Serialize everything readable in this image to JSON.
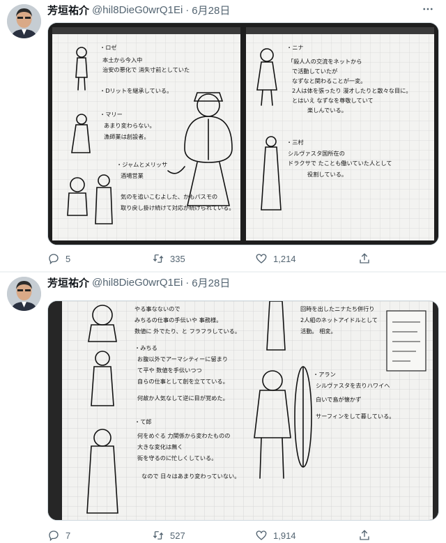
{
  "tweets": [
    {
      "author": {
        "name": "芳垣祐介",
        "handle": "@hil8DieG0wrQ1Ei"
      },
      "date": "6月28日",
      "metrics": {
        "replies": "5",
        "retweets": "335",
        "likes": "1,214"
      },
      "media_text": {
        "left": [
          "・ロゼ",
          "本土から今入中",
          "治安の悪化で 消失寸前としていた",
          "・Dリットを継承している。",
          "・マリー",
          "あまり変わらない。",
          "漁師業は創設者。",
          "・ジャムとメリッサ",
          "酒場営業",
          "気のを追いこむよした、かもパスモの",
          "取り戻し掛け続けて対応が続けられている。"
        ],
        "right": [
          "・ニナ",
          "「殺人人の交流をネットから",
          "で活動していたが",
          "なずなと関わることが一変。",
          "2人は体を張ったり 漫才したりと散々な目に。",
          "とはいえ なずなを尊敬していて",
          "楽しんでいる。",
          "・三村",
          "シルヴァスタ国所在の",
          "ドラクサで たことも働いていた人として",
          "役割している。"
        ]
      }
    },
    {
      "author": {
        "name": "芳垣祐介",
        "handle": "@hil8DieG0wrQ1Ei"
      },
      "date": "6月28日",
      "metrics": {
        "replies": "7",
        "retweets": "527",
        "likes": "1,914"
      },
      "media_text": {
        "left": [
          "やる事なないので",
          "みちるの仕事の手伝いや 事務様。",
          "数値に 外でたり、と フラフラしている。",
          "・みちる",
          "お腹以外でアーマシティーに留まり",
          "て平や 数値を手伝いつつ",
          "自らの仕事として創を立てている。",
          "何故か人気なして逆に目が覚めた。",
          "・て郎",
          "何をめぐる 力関係から変わたものの",
          "大きな変化は無く",
          "街を守るのに忙しくしている。",
          "なので 日々はあまり変わっていない。"
        ],
        "right": [
          "回時を出したニナたち併行り",
          "2人組のネットアイドルとして",
          "活動。 相変。",
          "・アラン",
          "シルヴァスタを去りハワイへ",
          "白いで島が懐かず",
          "サーフィンをして暮している。"
        ]
      }
    }
  ],
  "colors": {
    "text": "#0f1419",
    "secondary": "#536471",
    "border": "#cfd9de"
  },
  "icons": {
    "reply": "reply-icon",
    "retweet": "retweet-icon",
    "like": "heart-icon",
    "share": "share-icon",
    "more": "more-icon"
  }
}
